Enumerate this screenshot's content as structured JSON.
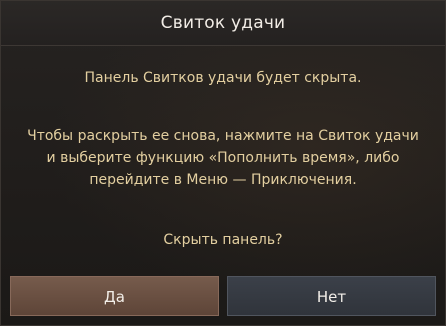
{
  "dialog": {
    "title": "Свиток удачи",
    "message_line1": "Панель Свитков удачи будет скрыта.",
    "message_lines": [
      "Чтобы раскрыть ее снова, нажмите на Свиток удачи",
      "и выберите функцию «Пополнить время», либо",
      "перейдите в Меню — Приключения."
    ],
    "question": "Скрыть панель?",
    "confirm_label": "Да",
    "cancel_label": "Нет"
  },
  "colors": {
    "title_text": "#f2ede6",
    "body_text": "#e3cfa0",
    "confirm_button": "#6a4f41",
    "cancel_button": "#363a42"
  }
}
